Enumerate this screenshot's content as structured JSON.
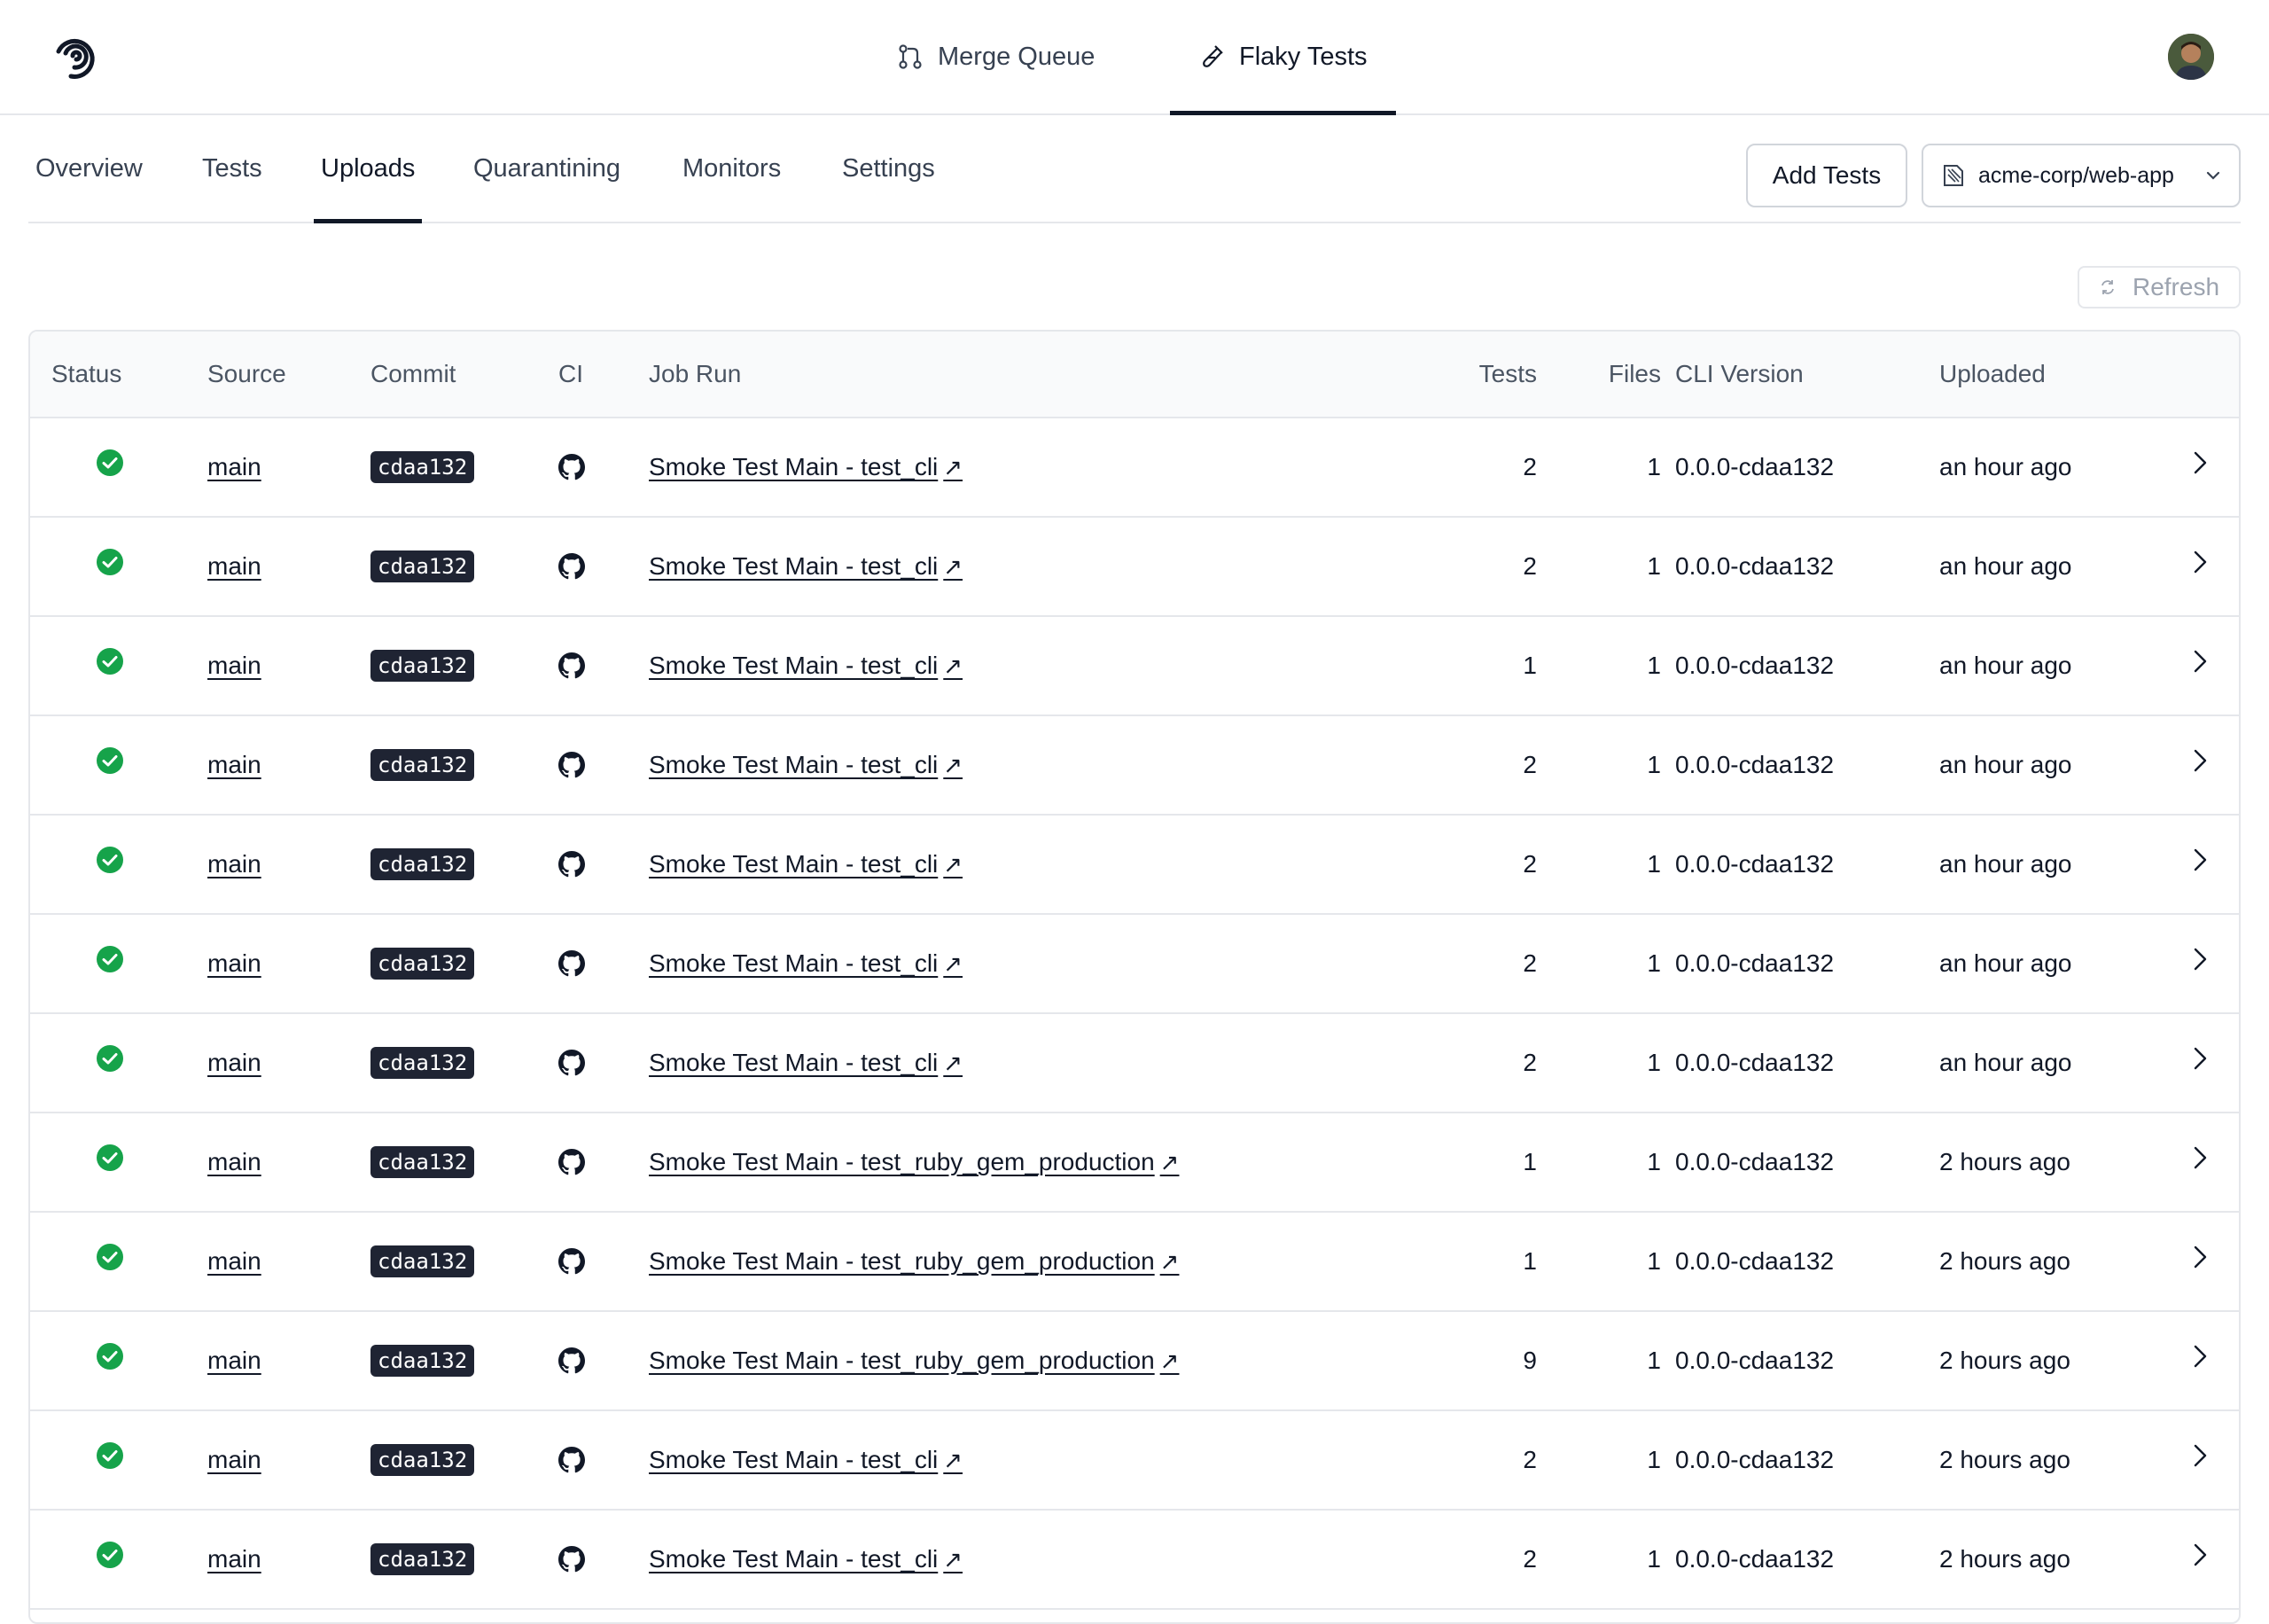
{
  "header": {
    "tabs": [
      {
        "label": "Merge Queue",
        "icon": "merge-icon",
        "active": false
      },
      {
        "label": "Flaky Tests",
        "icon": "test-tube-icon",
        "active": true
      }
    ],
    "logo": "trunk-logo",
    "avatar": "user-avatar"
  },
  "subnav": {
    "tabs": [
      {
        "label": "Overview",
        "active": false
      },
      {
        "label": "Tests",
        "active": false
      },
      {
        "label": "Uploads",
        "active": true
      },
      {
        "label": "Quarantining",
        "active": false
      },
      {
        "label": "Monitors",
        "active": false
      },
      {
        "label": "Settings",
        "active": false
      }
    ],
    "add_tests_label": "Add Tests",
    "repo": "acme-corp/web-app"
  },
  "refresh_label": "Refresh",
  "table": {
    "columns": [
      "Status",
      "Source",
      "Commit",
      "CI",
      "Job Run",
      "Tests",
      "Files",
      "CLI Version",
      "Uploaded"
    ],
    "rows": [
      {
        "status": "success",
        "source": "main",
        "commit": "cdaa132",
        "ci": "github",
        "job_run": "Smoke Test Main - test_cli",
        "tests": "2",
        "files": "1",
        "cli_version": "0.0.0-cdaa132",
        "uploaded": "an hour ago"
      },
      {
        "status": "success",
        "source": "main",
        "commit": "cdaa132",
        "ci": "github",
        "job_run": "Smoke Test Main - test_cli",
        "tests": "2",
        "files": "1",
        "cli_version": "0.0.0-cdaa132",
        "uploaded": "an hour ago"
      },
      {
        "status": "success",
        "source": "main",
        "commit": "cdaa132",
        "ci": "github",
        "job_run": "Smoke Test Main - test_cli",
        "tests": "1",
        "files": "1",
        "cli_version": "0.0.0-cdaa132",
        "uploaded": "an hour ago"
      },
      {
        "status": "success",
        "source": "main",
        "commit": "cdaa132",
        "ci": "github",
        "job_run": "Smoke Test Main - test_cli",
        "tests": "2",
        "files": "1",
        "cli_version": "0.0.0-cdaa132",
        "uploaded": "an hour ago"
      },
      {
        "status": "success",
        "source": "main",
        "commit": "cdaa132",
        "ci": "github",
        "job_run": "Smoke Test Main - test_cli",
        "tests": "2",
        "files": "1",
        "cli_version": "0.0.0-cdaa132",
        "uploaded": "an hour ago"
      },
      {
        "status": "success",
        "source": "main",
        "commit": "cdaa132",
        "ci": "github",
        "job_run": "Smoke Test Main - test_cli",
        "tests": "2",
        "files": "1",
        "cli_version": "0.0.0-cdaa132",
        "uploaded": "an hour ago"
      },
      {
        "status": "success",
        "source": "main",
        "commit": "cdaa132",
        "ci": "github",
        "job_run": "Smoke Test Main - test_cli",
        "tests": "2",
        "files": "1",
        "cli_version": "0.0.0-cdaa132",
        "uploaded": "an hour ago"
      },
      {
        "status": "success",
        "source": "main",
        "commit": "cdaa132",
        "ci": "github",
        "job_run": "Smoke Test Main - test_ruby_gem_production",
        "tests": "1",
        "files": "1",
        "cli_version": "0.0.0-cdaa132",
        "uploaded": "2 hours ago"
      },
      {
        "status": "success",
        "source": "main",
        "commit": "cdaa132",
        "ci": "github",
        "job_run": "Smoke Test Main - test_ruby_gem_production",
        "tests": "1",
        "files": "1",
        "cli_version": "0.0.0-cdaa132",
        "uploaded": "2 hours ago"
      },
      {
        "status": "success",
        "source": "main",
        "commit": "cdaa132",
        "ci": "github",
        "job_run": "Smoke Test Main - test_ruby_gem_production",
        "tests": "9",
        "files": "1",
        "cli_version": "0.0.0-cdaa132",
        "uploaded": "2 hours ago"
      },
      {
        "status": "success",
        "source": "main",
        "commit": "cdaa132",
        "ci": "github",
        "job_run": "Smoke Test Main - test_cli",
        "tests": "2",
        "files": "1",
        "cli_version": "0.0.0-cdaa132",
        "uploaded": "2 hours ago"
      },
      {
        "status": "success",
        "source": "main",
        "commit": "cdaa132",
        "ci": "github",
        "job_run": "Smoke Test Main - test_cli",
        "tests": "2",
        "files": "1",
        "cli_version": "0.0.0-cdaa132",
        "uploaded": "2 hours ago"
      }
    ]
  },
  "colors": {
    "success": "#16a34a",
    "badge_bg": "#1f2433",
    "border": "#e5e7eb",
    "header_bg": "#f9fafb",
    "active_tab": "#111827"
  }
}
